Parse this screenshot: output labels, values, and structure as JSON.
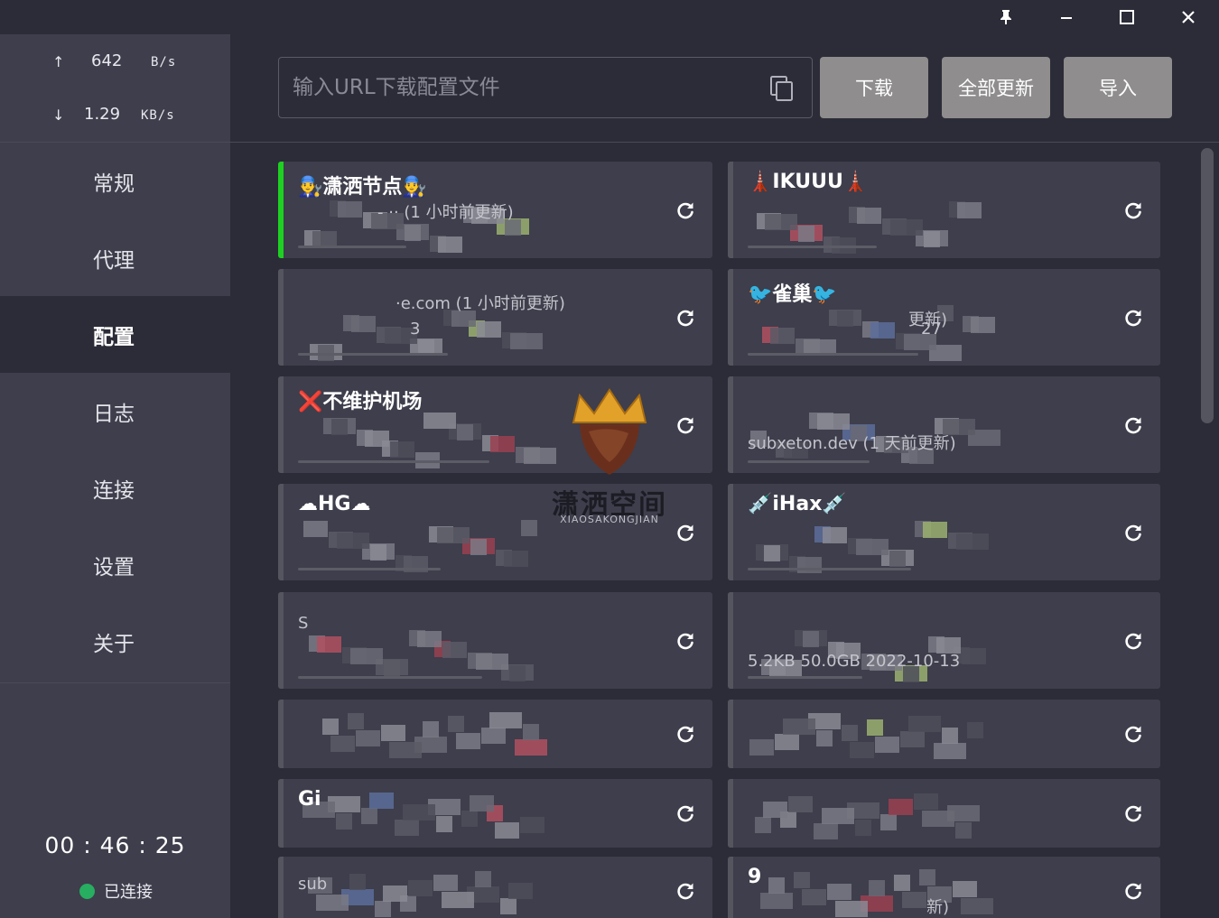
{
  "window": {
    "controls": [
      "pin-icon",
      "minimize-icon",
      "maximize-icon",
      "close-icon"
    ],
    "pin_glyph": "📌",
    "minimize_glyph": "—",
    "maximize_glyph": "☐",
    "close_glyph": "✕"
  },
  "traffic": {
    "up_arrow": "↑",
    "up_value": "642",
    "up_unit": "B/s",
    "down_arrow": "↓",
    "down_value": "1.29",
    "down_unit": "KB/s"
  },
  "nav": {
    "items": [
      {
        "label": "常规"
      },
      {
        "label": "代理"
      },
      {
        "label": "配置"
      },
      {
        "label": "日志"
      },
      {
        "label": "连接"
      },
      {
        "label": "设置"
      },
      {
        "label": "关于"
      }
    ],
    "active_index": 2
  },
  "timer": "00 : 46 : 25",
  "status": {
    "label": "已连接",
    "color": "#27ae60"
  },
  "toolbar": {
    "url_placeholder": "输入URL下载配置文件",
    "download_label": "下载",
    "update_all_label": "全部更新",
    "import_label": "导入"
  },
  "profiles": [
    {
      "title": "👨‍🔧潇洒节点👨‍🔧",
      "line1": "- ·· (1 小时前更新)",
      "line2": "",
      "active": true
    },
    {
      "title": "🗼IKUUU🗼",
      "line1": "",
      "line2": "",
      "active": false
    },
    {
      "title": "",
      "line1": "·e.com (1 小时前更新)",
      "line2": "3",
      "active": false
    },
    {
      "title": "🐦雀巢🐦",
      "line1": "更新)",
      "line2": "27",
      "active": false
    },
    {
      "title": "❌不维护机场",
      "line1": "",
      "line2": "",
      "active": false
    },
    {
      "title": "",
      "line1": "",
      "line2": "subxeton.dev (1 天前更新)",
      "active": false
    },
    {
      "title": "☁HG☁",
      "line1": "",
      "line2": "",
      "active": false
    },
    {
      "title": "💉iHax💉",
      "line1": "",
      "line2": "",
      "active": false
    },
    {
      "title": "",
      "line1": "S",
      "line2": "",
      "active": false
    },
    {
      "title": "",
      "line1": "5.2KB   50.0GB   2022-10-13",
      "line2": "",
      "active": false
    },
    {
      "title": "",
      "line1": "",
      "line2": "",
      "active": false
    },
    {
      "title": "",
      "line1": "",
      "line2": "",
      "active": false
    },
    {
      "title": "Gi",
      "line1": "",
      "line2": "",
      "active": false
    },
    {
      "title": "",
      "line1": "",
      "line2": "",
      "active": false
    },
    {
      "title": "",
      "line1": "sub",
      "line2": "",
      "active": false
    },
    {
      "title": "9",
      "line1": "新)",
      "line2": "",
      "active": false
    }
  ],
  "watermark": {
    "title": "潇洒空间",
    "subtitle": "XIAOSAKONGJIAN"
  },
  "colors": {
    "bg": "#2c2c38",
    "panel": "#3e3e4c",
    "accent_active": "#1ed120",
    "button": "#8f8d8d"
  }
}
